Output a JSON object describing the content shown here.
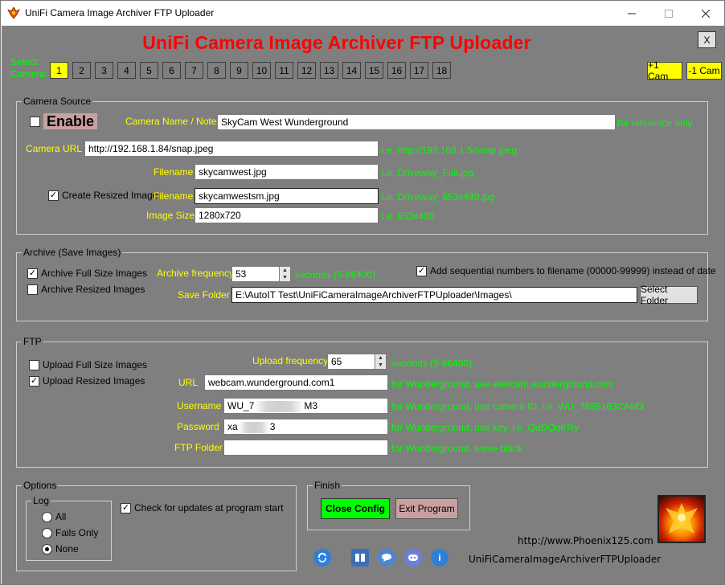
{
  "window": {
    "title": "UniFi Camera Image Archiver FTP Uploader"
  },
  "heading": "UniFi Camera Image Archiver FTP Uploader",
  "close_x": "X",
  "select_camera": {
    "line1": "Select",
    "line2": "Camera:"
  },
  "cameras": [
    "1",
    "2",
    "3",
    "4",
    "5",
    "6",
    "7",
    "8",
    "9",
    "10",
    "11",
    "12",
    "13",
    "14",
    "15",
    "16",
    "17",
    "18"
  ],
  "selected_camera": "1",
  "cam_add": "+1 Cam",
  "cam_remove": "-1 Cam",
  "camera_source": {
    "title": "Camera Source",
    "enable_label": "Enable",
    "name_label": "Camera Name / Notes",
    "name_value": "SkyCam West Wunderground",
    "name_hint": "for reference only",
    "url_label": "Camera URL",
    "url_value": "http://192.168.1.84/snap.jpeg",
    "url_hint": "i.e. http://192.168.1.5/snap.jpeg",
    "filename_label": "Filename",
    "filename_value": "skycamwest.jpg",
    "filename_hint": "i.e. Driveway_Full.jpg",
    "resize_label": "Create Resized Image",
    "resized_filename_label": "Filename",
    "resized_filename_value": "skycamwestsm.jpg",
    "resized_filename_hint": "i.e. Driveway_853x480.jpg",
    "size_label": "Image Size",
    "size_value": "1280x720",
    "size_hint": "i.e. 853x480"
  },
  "archive": {
    "title": "Archive (Save Images)",
    "full_label": "Archive Full Size Images",
    "resized_label": "Archive Resized Images",
    "freq_label": "Archive frequency",
    "freq_value": "53",
    "freq_hint": "seconds (5-86400)",
    "seq_label": "Add sequential numbers to filename (00000-99999) instead of date",
    "folder_label": "Save Folder",
    "folder_value": "E:\\AutoIT Test\\UniFiCameraImageArchiverFTPUploader\\Images\\",
    "select_folder": "Select Folder"
  },
  "ftp": {
    "title": "FTP",
    "full_label": "Upload Full Size Images",
    "resized_label": "Upload Resized Images",
    "freq_label": "Upload frequency",
    "freq_value": "65",
    "freq_hint": "seconds (5-86400)",
    "url_label": "URL",
    "url_value": "webcam.wunderground.com1",
    "url_hint": "for Wunderground, use webcam.wunderground.com",
    "user_label": "Username",
    "user_prefix": "WU_7",
    "user_suffix": "M3",
    "user_hint": "for Wunderground, use camera ID.  i.e. WU_7886163CAM3",
    "pass_label": "Password",
    "pass_prefix": "xa",
    "pass_suffix": "3",
    "pass_hint": "for Wunderground, use key. i.e. QqDQqKRy",
    "folder_label": "FTP Folder",
    "folder_value": "",
    "folder_hint": "for Wunderground, leave blank"
  },
  "options": {
    "title": "Options",
    "log_title": "Log",
    "log_all": "All",
    "log_fails": "Fails Only",
    "log_none": "None",
    "updates_label": "Check for updates at program start"
  },
  "finish": {
    "title": "Finish",
    "close_config": "Close Config",
    "exit_program": "Exit Program"
  },
  "footer": {
    "url": "http://www.Phoenix125.com",
    "app_name": "UniFiCameraImageArchiverFTPUploader"
  },
  "colors": {
    "accent_green": "#00ff00",
    "accent_yellow": "#ffff00",
    "heading_red": "#ff0000",
    "bg_gray": "#7f7f7f"
  }
}
